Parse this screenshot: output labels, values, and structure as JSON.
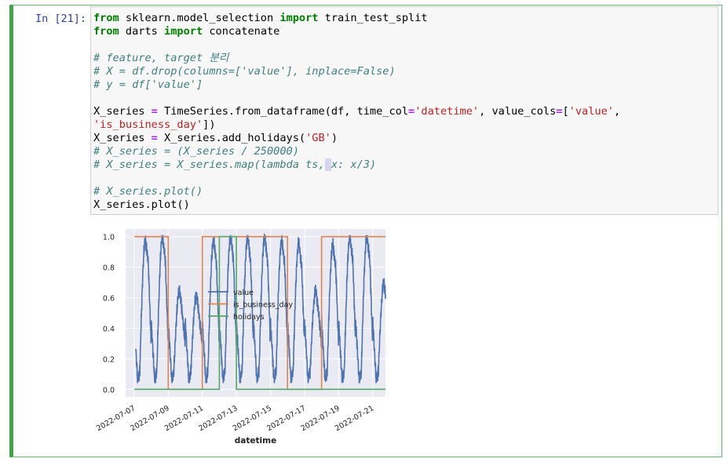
{
  "cell": {
    "prompt": "In [21]:",
    "code_lines": [
      [
        {
          "t": "from",
          "c": "kw"
        },
        {
          "t": " sklearn.model_selection "
        },
        {
          "t": "import",
          "c": "kw"
        },
        {
          "t": " train_test_split"
        }
      ],
      [
        {
          "t": "from",
          "c": "kw"
        },
        {
          "t": " darts "
        },
        {
          "t": "import",
          "c": "kw"
        },
        {
          "t": " concatenate"
        }
      ],
      [],
      [
        {
          "t": "# feature, target 분리",
          "c": "cm"
        }
      ],
      [
        {
          "t": "# X = df.drop(columns=['value'], inplace=False)",
          "c": "cm"
        }
      ],
      [
        {
          "t": "# y = df['value']",
          "c": "cm"
        }
      ],
      [],
      [
        {
          "t": "X_series "
        },
        {
          "t": "=",
          "c": "op"
        },
        {
          "t": " TimeSeries.from_dataframe(df, time_col"
        },
        {
          "t": "=",
          "c": "op"
        },
        {
          "t": "'datetime'",
          "c": "str"
        },
        {
          "t": ", value_cols"
        },
        {
          "t": "=",
          "c": "op"
        },
        {
          "t": "["
        },
        {
          "t": "'value'",
          "c": "str"
        },
        {
          "t": ","
        }
      ],
      [
        {
          "t": "'is_business_day'",
          "c": "str"
        },
        {
          "t": "])"
        }
      ],
      [
        {
          "t": "X_series "
        },
        {
          "t": "=",
          "c": "op"
        },
        {
          "t": " X_series.add_holidays("
        },
        {
          "t": "'GB'",
          "c": "str"
        },
        {
          "t": ")"
        }
      ],
      [
        {
          "t": "# X_series = (X_series / 250000)",
          "c": "cm"
        }
      ],
      [
        {
          "t": "# X_series = X_series.map(lambda ts,",
          "c": "cm"
        },
        {
          "t": " ",
          "c": "cm sel"
        },
        {
          "t": "x: x/3)",
          "c": "cm"
        }
      ],
      [],
      [
        {
          "t": "# X_series.plot()",
          "c": "cm"
        }
      ],
      [
        {
          "t": "X_series.plot()"
        }
      ]
    ]
  },
  "chart_data": {
    "type": "line",
    "xlabel": "datetime",
    "ylabel": "",
    "x_tick_labels": [
      "2022-07-07",
      "2022-07-09",
      "2022-07-11",
      "2022-07-13",
      "2022-07-15",
      "2022-07-17",
      "2022-07-19",
      "2022-07-21"
    ],
    "y_tick_labels": [
      "0.0",
      "0.2",
      "0.4",
      "0.6",
      "0.8",
      "1.0"
    ],
    "xlim": [
      "2022-07-06T12:00",
      "2022-07-21T18:00"
    ],
    "ylim": [
      -0.05,
      1.05
    ],
    "grid": true,
    "background": "#eaeaf2",
    "legend": {
      "placement": "center"
    },
    "series": [
      {
        "name": "value",
        "color": "#4c72b0",
        "shape": "daily cycle, min ~0.05, peak ~1.0; weekend/holiday peaks ~0.6–0.65",
        "daily_peaks": [
          {
            "day": "2022-07-07",
            "peak": 0.98
          },
          {
            "day": "2022-07-08",
            "peak": 1.0
          },
          {
            "day": "2022-07-09",
            "peak": 0.65
          },
          {
            "day": "2022-07-10",
            "peak": 0.62
          },
          {
            "day": "2022-07-11",
            "peak": 0.98
          },
          {
            "day": "2022-07-12",
            "peak": 1.0
          },
          {
            "day": "2022-07-13",
            "peak": 1.0
          },
          {
            "day": "2022-07-14",
            "peak": 1.0
          },
          {
            "day": "2022-07-15",
            "peak": 0.98
          },
          {
            "day": "2022-07-16",
            "peak": 0.96
          },
          {
            "day": "2022-07-17",
            "peak": 0.65
          },
          {
            "day": "2022-07-18",
            "peak": 0.95
          },
          {
            "day": "2022-07-19",
            "peak": 1.0
          },
          {
            "day": "2022-07-20",
            "peak": 1.0
          },
          {
            "day": "2022-07-21",
            "peak": 0.7
          }
        ]
      },
      {
        "name": "is_business_day",
        "color": "#dd8452",
        "segments": [
          {
            "from": "2022-07-07",
            "to": "2022-07-09",
            "value": 1
          },
          {
            "from": "2022-07-09",
            "to": "2022-07-11",
            "value": 0
          },
          {
            "from": "2022-07-11",
            "to": "2022-07-16",
            "value": 1
          },
          {
            "from": "2022-07-16",
            "to": "2022-07-18",
            "value": 0
          },
          {
            "from": "2022-07-18",
            "to": "2022-07-21T18:00",
            "value": 1
          }
        ]
      },
      {
        "name": "holidays",
        "color": "#55a868",
        "segments": [
          {
            "from": "2022-07-07",
            "to": "2022-07-12",
            "value": 0
          },
          {
            "from": "2022-07-12",
            "to": "2022-07-13",
            "value": 1
          },
          {
            "from": "2022-07-13",
            "to": "2022-07-21T18:00",
            "value": 0
          }
        ]
      }
    ]
  }
}
